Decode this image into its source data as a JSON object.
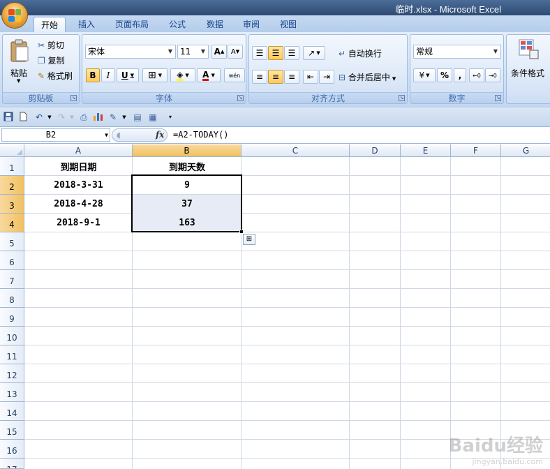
{
  "window": {
    "title": "临时.xlsx - Microsoft Excel"
  },
  "tabs": [
    "开始",
    "插入",
    "页面布局",
    "公式",
    "数据",
    "审阅",
    "视图"
  ],
  "ribbon": {
    "clipboard": {
      "paste": "粘贴",
      "cut": "剪切",
      "copy": "复制",
      "format_painter": "格式刷",
      "label": "剪贴板"
    },
    "font": {
      "name": "宋体",
      "size": "11",
      "bold": "B",
      "italic": "I",
      "underline": "U",
      "label": "字体",
      "grow": "A",
      "shrink": "A",
      "font_color": "A",
      "phonetic": "wén"
    },
    "alignment": {
      "wrap": "自动换行",
      "merge": "合并后居中",
      "label": "对齐方式"
    },
    "number": {
      "format": "常规",
      "percent": "%",
      "comma": ",",
      "label": "数字"
    },
    "styles": {
      "conditional": "条件格式"
    }
  },
  "formula_bar": {
    "name_box": "B2",
    "fx": "fx",
    "formula": "=A2-TODAY()"
  },
  "sheet": {
    "columns": [
      "A",
      "B",
      "C",
      "D",
      "E",
      "F",
      "G"
    ],
    "rows": [
      "1",
      "2",
      "3",
      "4",
      "5",
      "6",
      "7",
      "8",
      "9",
      "10",
      "11",
      "12",
      "13",
      "14",
      "15",
      "16",
      "17"
    ],
    "cells": {
      "A1": "到期日期",
      "B1": "到期天数",
      "A2": "2018-3-31",
      "B2": "9",
      "A3": "2018-4-28",
      "B3": "37",
      "A4": "2018-9-1",
      "B4": "163"
    }
  },
  "watermark": {
    "brand": "Baidu经验",
    "url": "jingyan.baidu.com"
  }
}
